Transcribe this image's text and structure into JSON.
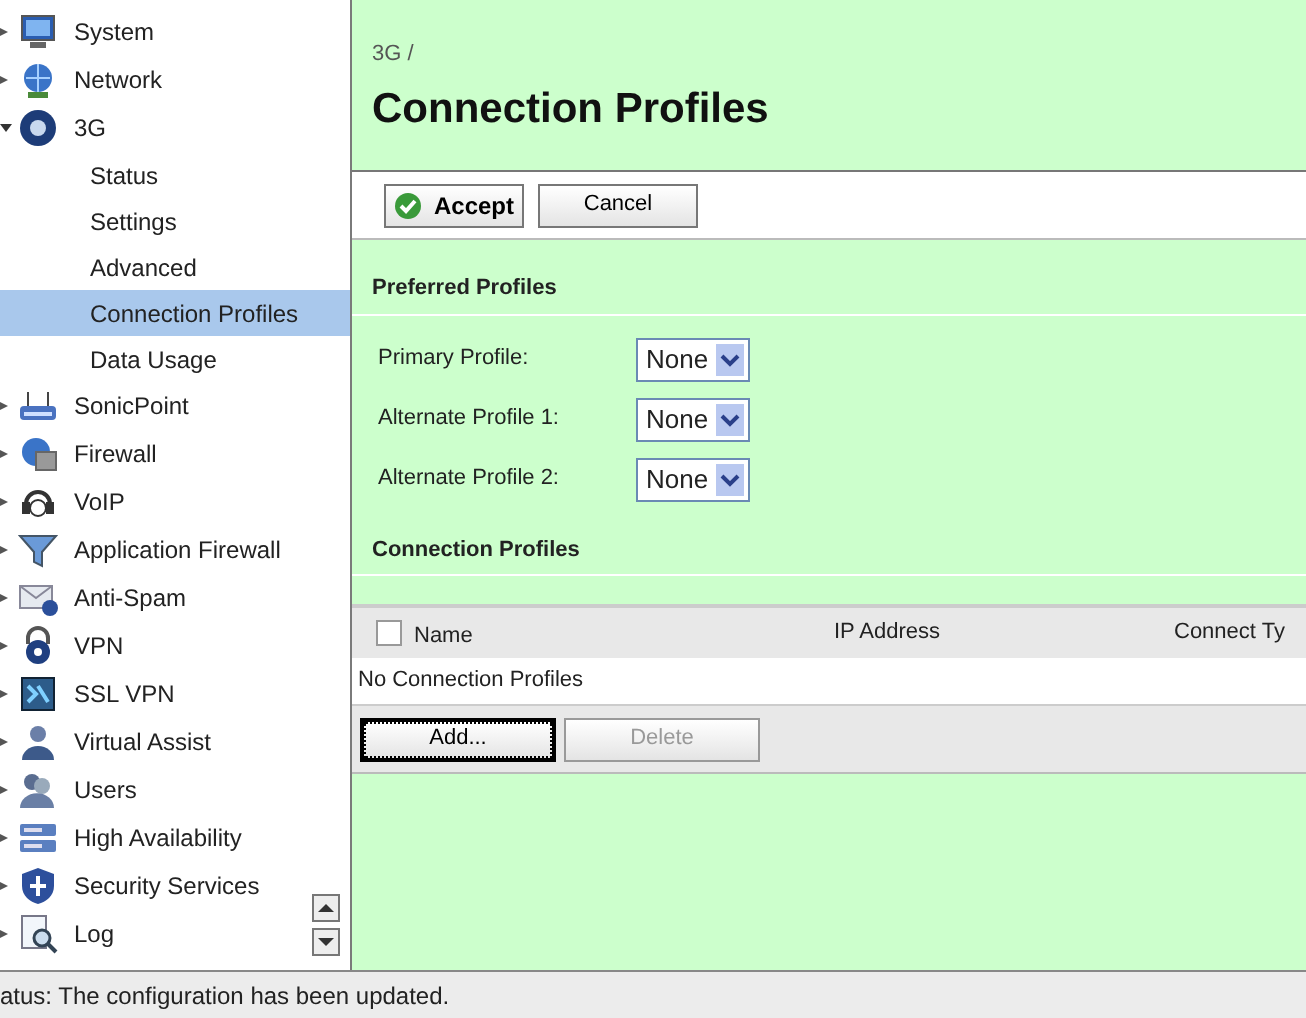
{
  "sidebar": {
    "items": [
      {
        "label": "System",
        "expanded": false
      },
      {
        "label": "Network",
        "expanded": false
      },
      {
        "label": "3G",
        "expanded": true,
        "children": [
          {
            "label": "Status",
            "selected": false
          },
          {
            "label": "Settings",
            "selected": false
          },
          {
            "label": "Advanced",
            "selected": false
          },
          {
            "label": "Connection Profiles",
            "selected": true
          },
          {
            "label": "Data Usage",
            "selected": false
          }
        ]
      },
      {
        "label": "SonicPoint",
        "expanded": false
      },
      {
        "label": "Firewall",
        "expanded": false
      },
      {
        "label": "VoIP",
        "expanded": false
      },
      {
        "label": "Application Firewall",
        "expanded": false
      },
      {
        "label": "Anti-Spam",
        "expanded": false
      },
      {
        "label": "VPN",
        "expanded": false
      },
      {
        "label": "SSL VPN",
        "expanded": false
      },
      {
        "label": "Virtual Assist",
        "expanded": false
      },
      {
        "label": "Users",
        "expanded": false
      },
      {
        "label": "High Availability",
        "expanded": false
      },
      {
        "label": "Security Services",
        "expanded": false
      },
      {
        "label": "Log",
        "expanded": false
      }
    ]
  },
  "breadcrumb": "3G /",
  "title": "Connection Profiles",
  "toolbar": {
    "buttons": [
      {
        "label": "Accept",
        "kind": "accept"
      },
      {
        "label": "Cancel",
        "kind": "plain"
      }
    ]
  },
  "preferred": {
    "heading": "Preferred Profiles",
    "fields": [
      {
        "label": "Primary Profile:",
        "value": "None"
      },
      {
        "label": "Alternate Profile 1:",
        "value": "None"
      },
      {
        "label": "Alternate Profile 2:",
        "value": "None"
      }
    ]
  },
  "profiles": {
    "heading": "Connection Profiles",
    "columns": [
      "Name",
      "IP Address",
      "Connect Ty"
    ],
    "select_all_checked": false,
    "empty_text": "No Connection Profiles",
    "buttons": [
      {
        "label": "Add...",
        "disabled": false,
        "focused": true
      },
      {
        "label": "Delete",
        "disabled": true,
        "focused": false
      }
    ]
  },
  "status_bar": "atus: The configuration has been updated."
}
